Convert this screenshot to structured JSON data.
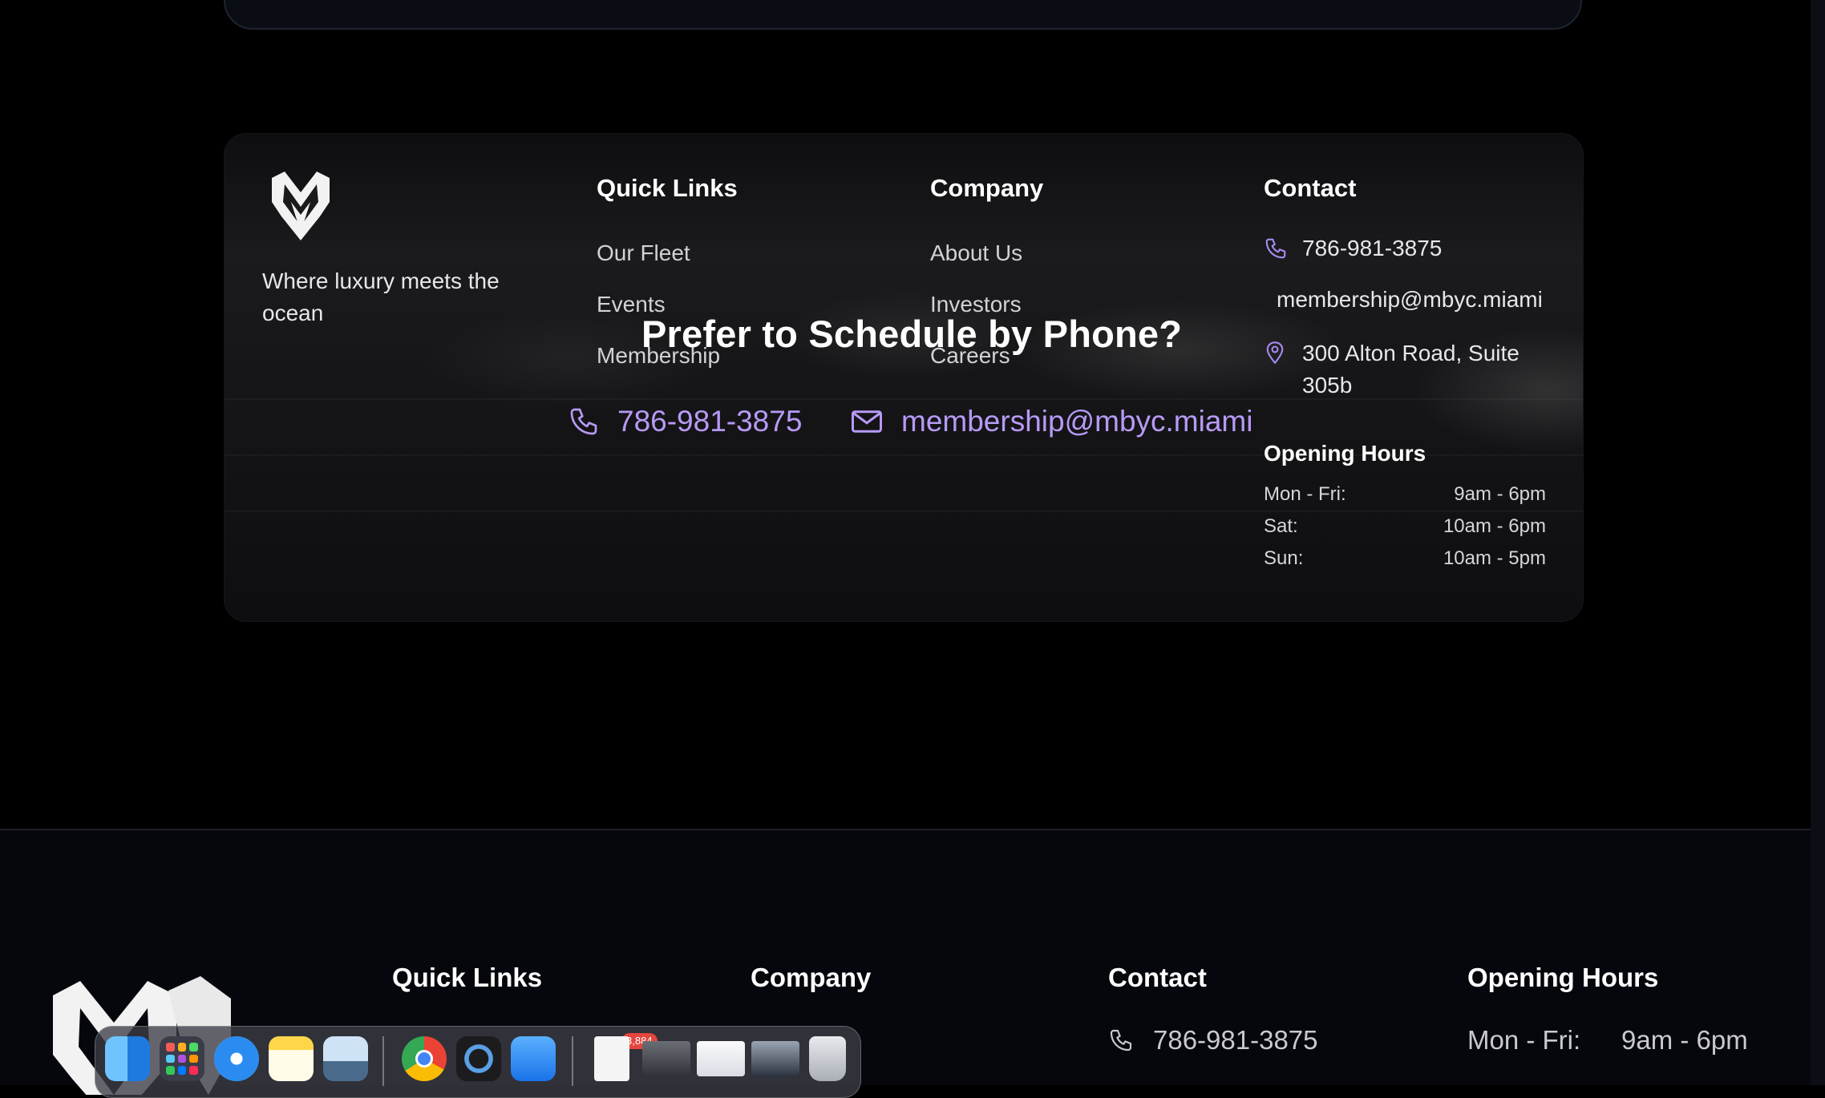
{
  "footer": {
    "tagline": "Where luxury meets the ocean",
    "quick_links": {
      "title": "Quick Links",
      "items": [
        "Our Fleet",
        "Events",
        "Membership"
      ]
    },
    "company": {
      "title": "Company",
      "items": [
        "About Us",
        "Investors",
        "Careers"
      ]
    },
    "contact": {
      "title": "Contact",
      "phone": "786-981-3875",
      "email": "membership@mbyc.miami",
      "address": "300 Alton Road, Suite 305b"
    },
    "hours": {
      "title": "Opening Hours",
      "rows": [
        {
          "day": "Mon - Fri:",
          "time": "9am - 6pm"
        },
        {
          "day": "Sat:",
          "time": "10am - 6pm"
        },
        {
          "day": "Sun:",
          "time": "10am - 5pm"
        }
      ]
    }
  },
  "overlay": {
    "title": "Prefer to Schedule by Phone?",
    "phone": "786-981-3875",
    "email": "membership@mbyc.miami"
  },
  "bottom_footer": {
    "quick_links_title": "Quick Links",
    "company_title": "Company",
    "contact_title": "Contact",
    "hours_title": "Opening Hours",
    "phone": "786-981-3875",
    "hours_day": "Mon - Fri:",
    "hours_time": "9am - 6pm"
  },
  "dock": {
    "mail_badge": "3,884",
    "icons": [
      "finder-icon",
      "launchpad-icon",
      "safari-icon",
      "notes-icon",
      "preview-icon",
      "chrome-icon",
      "quicktime-icon",
      "mail-icon",
      "document-icon",
      "window-thumbnail-icon",
      "window-thumbnail-icon",
      "window-thumbnail-icon",
      "trash-icon"
    ]
  },
  "colors": {
    "accent": "#b79af6",
    "icon_purple": "#a98af0",
    "background": "#000000"
  }
}
